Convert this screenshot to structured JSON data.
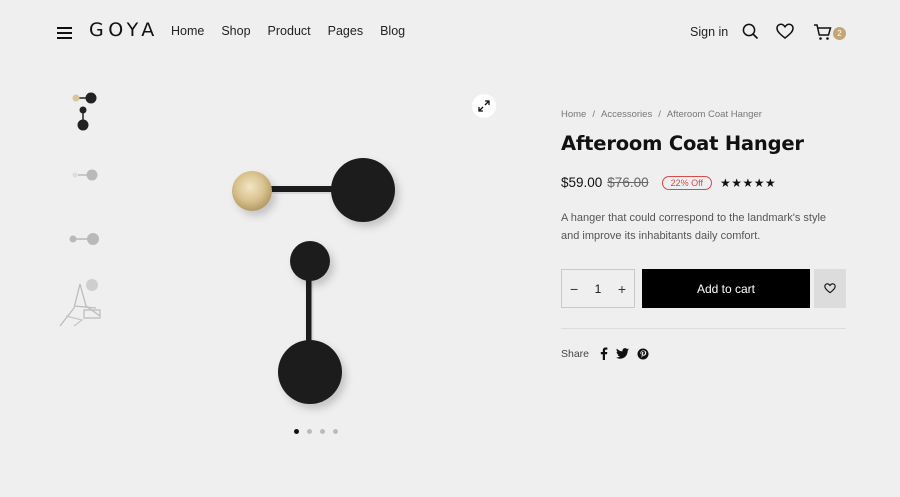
{
  "header": {
    "logo": "GOYA",
    "nav": [
      "Home",
      "Shop",
      "Product",
      "Pages",
      "Blog"
    ],
    "signin": "Sign in",
    "cart_count": "2",
    "icons": [
      "menu-icon",
      "search-icon",
      "heart-icon",
      "cart-icon"
    ]
  },
  "gallery": {
    "thumbnails": [
      "thumb-1",
      "thumb-2",
      "thumb-3",
      "thumb-4"
    ],
    "dots": 4,
    "active_dot": 0
  },
  "product": {
    "breadcrumb": [
      "Home",
      "Accessories",
      "Afteroom Coat Hanger"
    ],
    "breadcrumb_sep": "/",
    "title": "Afteroom Coat Hanger",
    "price": "$59.00",
    "old_price": "$76.00",
    "discount": "22% Off",
    "rating_stars": "★★★★★",
    "description": "A hanger that could correspond to the landmark's style and improve its inhabitants daily comfort.",
    "quantity": "1",
    "add_to_cart": "Add to cart",
    "share_label": "Share",
    "share_icons": [
      "facebook-icon",
      "twitter-icon",
      "pinterest-icon"
    ]
  },
  "colors": {
    "background": "#efefef",
    "accent_gold": "#c4a573",
    "discount_red": "#d54b4b",
    "button_black": "#000000"
  }
}
